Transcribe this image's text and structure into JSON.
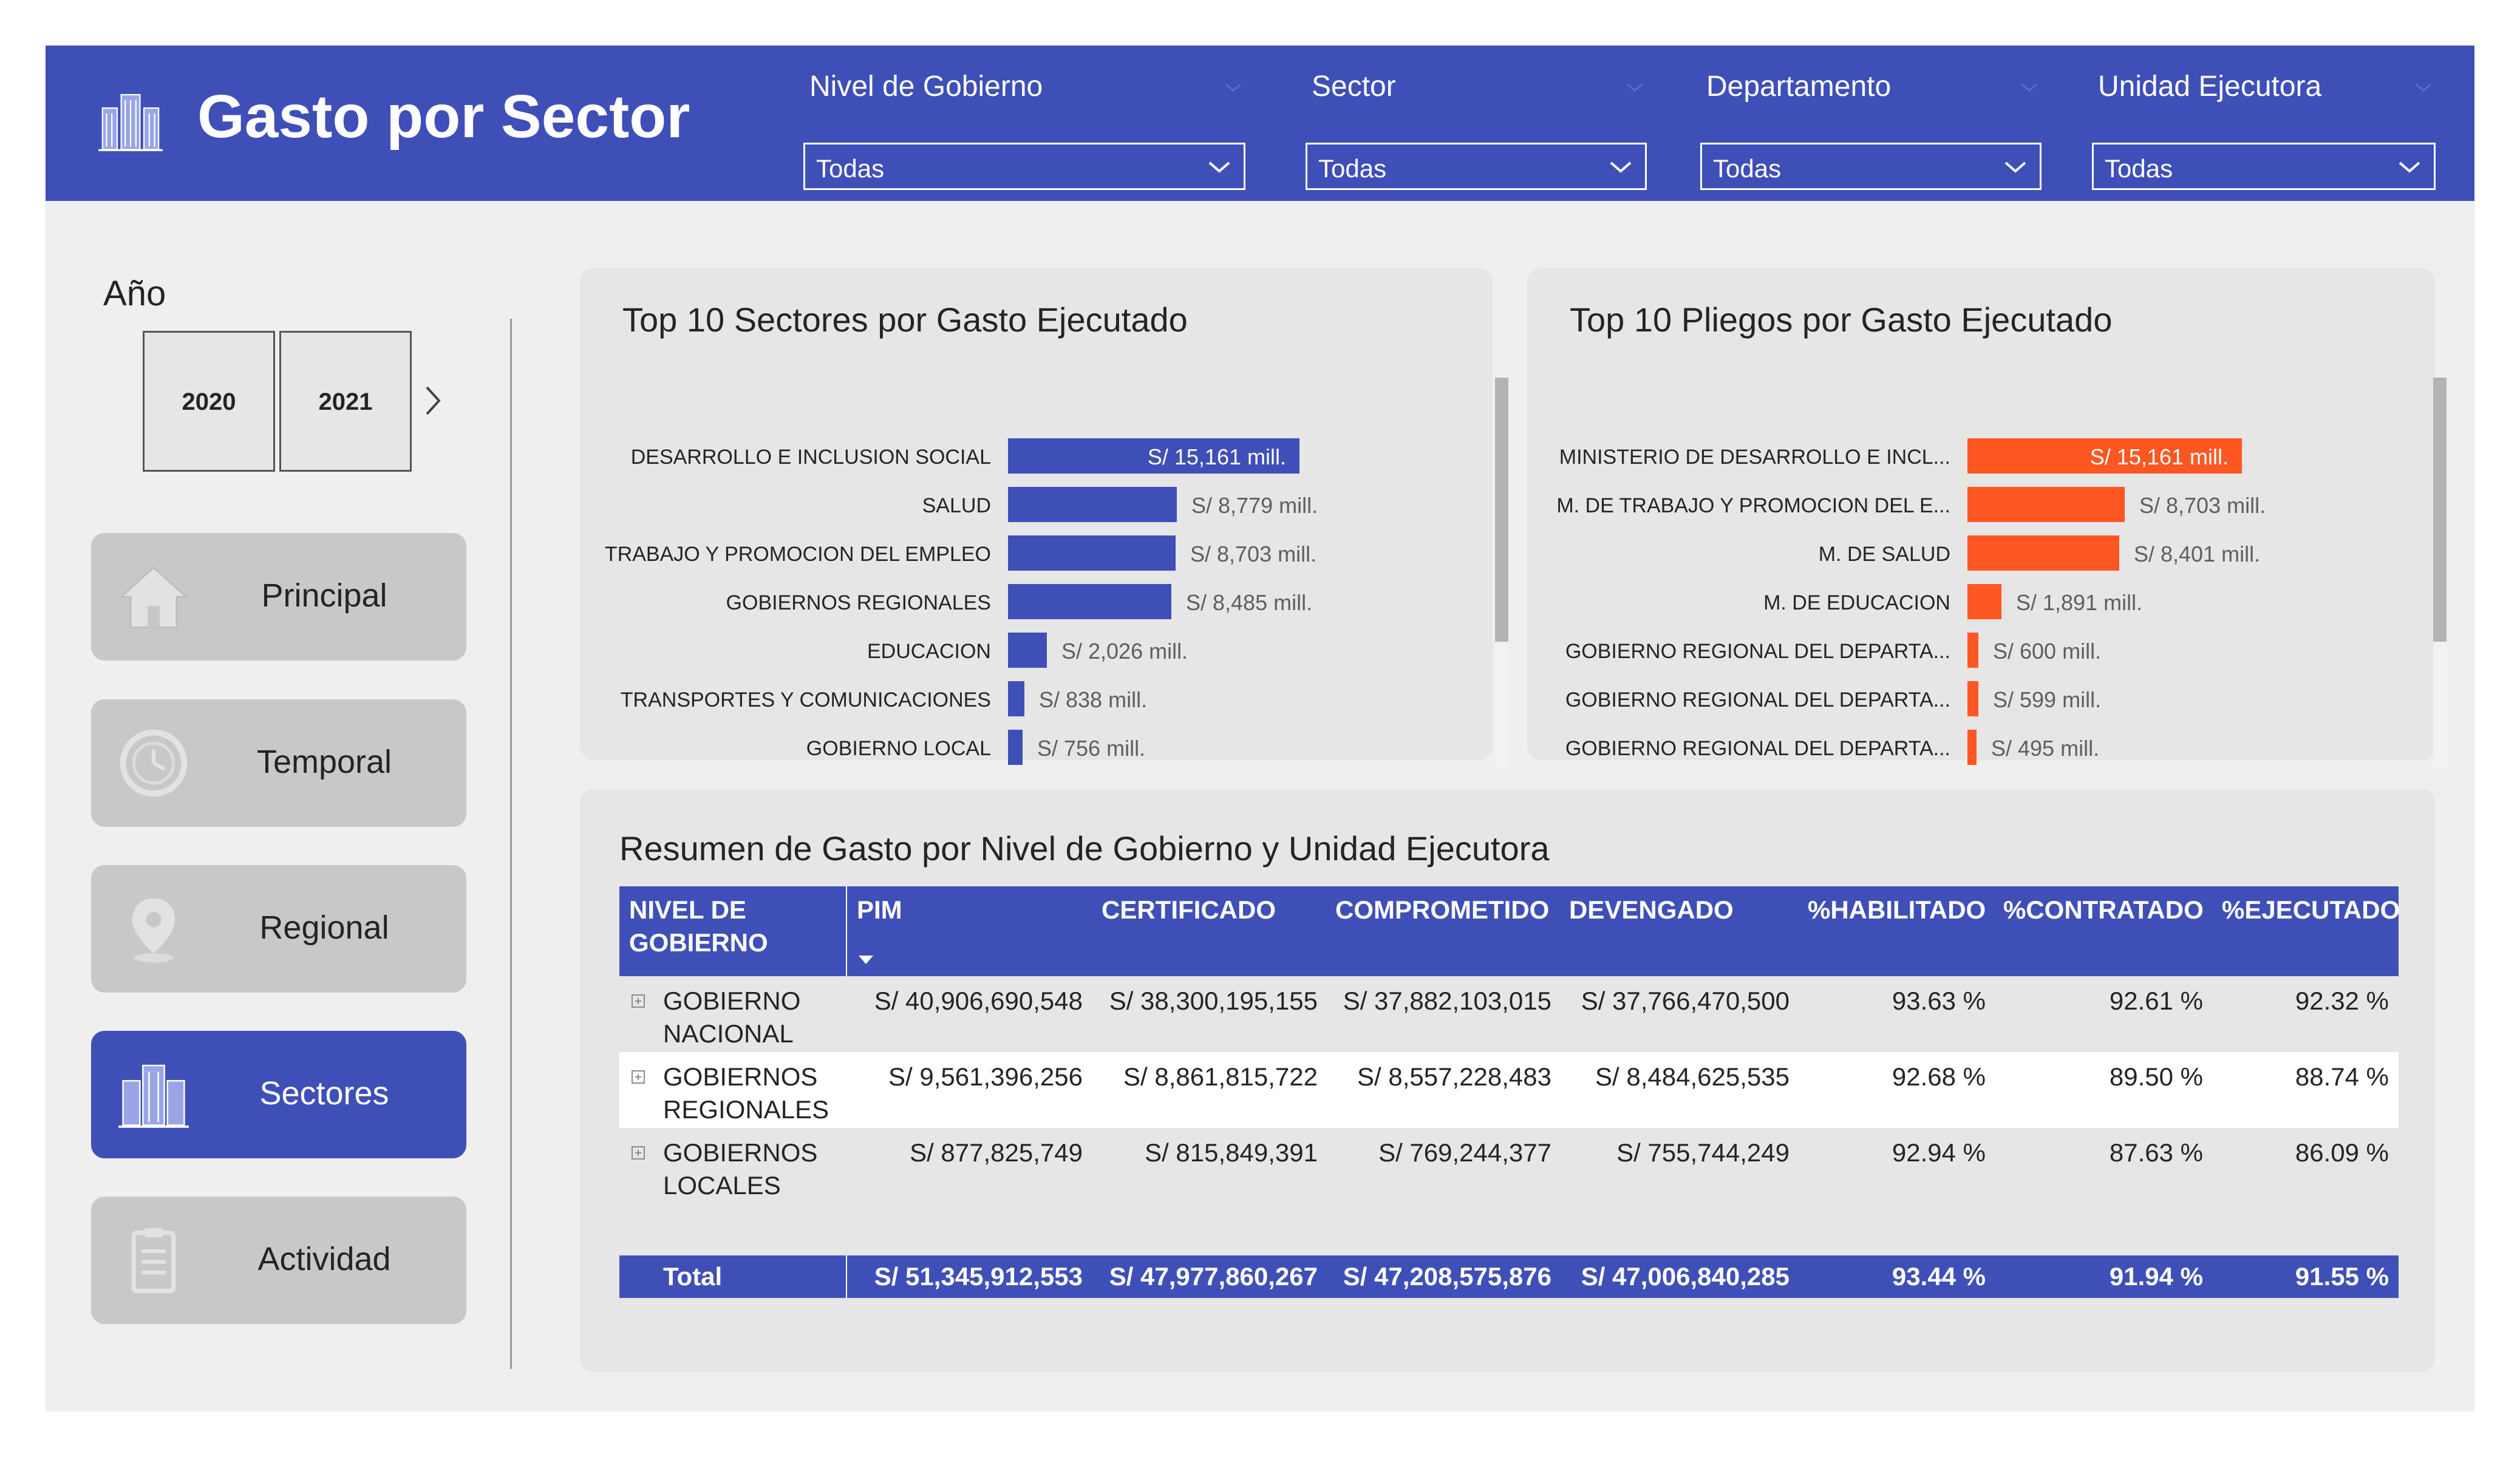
{
  "header": {
    "title": "Gasto por Sector",
    "filters": [
      {
        "label": "Nivel de Gobierno",
        "value": "Todas"
      },
      {
        "label": "Sector",
        "value": "Todas"
      },
      {
        "label": "Departamento",
        "value": "Todas"
      },
      {
        "label": "Unidad Ejecutora",
        "value": "Todas"
      }
    ]
  },
  "year_slicer": {
    "title": "Año",
    "years": [
      "2020",
      "2021"
    ]
  },
  "nav": {
    "items": [
      "Principal",
      "Temporal",
      "Regional",
      "Sectores",
      "Actividad"
    ],
    "active": "Sectores"
  },
  "colors": {
    "brand": "#3f4fb8",
    "accent_orange": "#ff5722",
    "background": "#efefef",
    "panel": "#e6e6e6"
  },
  "chart_data": [
    {
      "type": "bar",
      "orientation": "horizontal",
      "title": "Top 10 Sectores por Gasto Ejecutado",
      "categories": [
        "DESARROLLO E INCLUSION SOCIAL",
        "SALUD",
        "TRABAJO Y PROMOCION DEL EMPLEO",
        "GOBIERNOS REGIONALES",
        "EDUCACION",
        "TRANSPORTES Y COMUNICACIONES",
        "GOBIERNO LOCAL"
      ],
      "values": [
        15161,
        8779,
        8703,
        8485,
        2026,
        838,
        756
      ],
      "labels": [
        "S/ 15,161 mill.",
        "S/ 8,779 mill.",
        "S/ 8,703 mill.",
        "S/ 8,485 mill.",
        "S/ 2,026 mill.",
        "S/ 838 mill.",
        "S/ 756 mill."
      ],
      "color": "#3f4fb8"
    },
    {
      "type": "bar",
      "orientation": "horizontal",
      "title": "Top 10 Pliegos por Gasto Ejecutado",
      "categories": [
        "MINISTERIO DE DESARROLLO E INCL...",
        "M. DE TRABAJO Y PROMOCION DEL E...",
        "M. DE SALUD",
        "M. DE EDUCACION",
        "GOBIERNO REGIONAL DEL DEPARTA...",
        "GOBIERNO REGIONAL DEL DEPARTA...",
        "GOBIERNO REGIONAL DEL DEPARTA..."
      ],
      "values": [
        15161,
        8703,
        8401,
        1891,
        600,
        599,
        495
      ],
      "labels": [
        "S/ 15,161 mill.",
        "S/ 8,703 mill.",
        "S/ 8,401 mill.",
        "S/ 1,891 mill.",
        "S/ 600 mill.",
        "S/ 599 mill.",
        "S/ 495 mill."
      ],
      "color": "#ff5722"
    }
  ],
  "summary_table": {
    "title": "Resumen de Gasto por Nivel de Gobierno y Unidad Ejecutora",
    "columns": [
      "NIVEL DE GOBIERNO",
      "PIM",
      "CERTIFICADO",
      "COMPROMETIDO",
      "DEVENGADO",
      "%HABILITADO",
      "%CONTRATADO",
      "%EJECUTADO"
    ],
    "rows": [
      {
        "name": "GOBIERNO NACIONAL",
        "pim": "S/ 40,906,690,548",
        "certificado": "S/ 38,300,195,155",
        "comprometido": "S/ 37,882,103,015",
        "devengado": "S/ 37,766,470,500",
        "habilitado": "93.63 %",
        "contratado": "92.61 %",
        "ejecutado": "92.32 %"
      },
      {
        "name": "GOBIERNOS REGIONALES",
        "pim": "S/ 9,561,396,256",
        "certificado": "S/ 8,861,815,722",
        "comprometido": "S/ 8,557,228,483",
        "devengado": "S/ 8,484,625,535",
        "habilitado": "92.68 %",
        "contratado": "89.50 %",
        "ejecutado": "88.74 %"
      },
      {
        "name": "GOBIERNOS LOCALES",
        "pim": "S/ 877,825,749",
        "certificado": "S/ 815,849,391",
        "comprometido": "S/ 769,244,377",
        "devengado": "S/ 755,744,249",
        "habilitado": "92.94 %",
        "contratado": "87.63 %",
        "ejecutado": "86.09 %"
      }
    ],
    "total": {
      "name": "Total",
      "pim": "S/ 51,345,912,553",
      "certificado": "S/ 47,977,860,267",
      "comprometido": "S/ 47,208,575,876",
      "devengado": "S/ 47,006,840,285",
      "habilitado": "93.44 %",
      "contratado": "91.94 %",
      "ejecutado": "91.55 %"
    }
  }
}
